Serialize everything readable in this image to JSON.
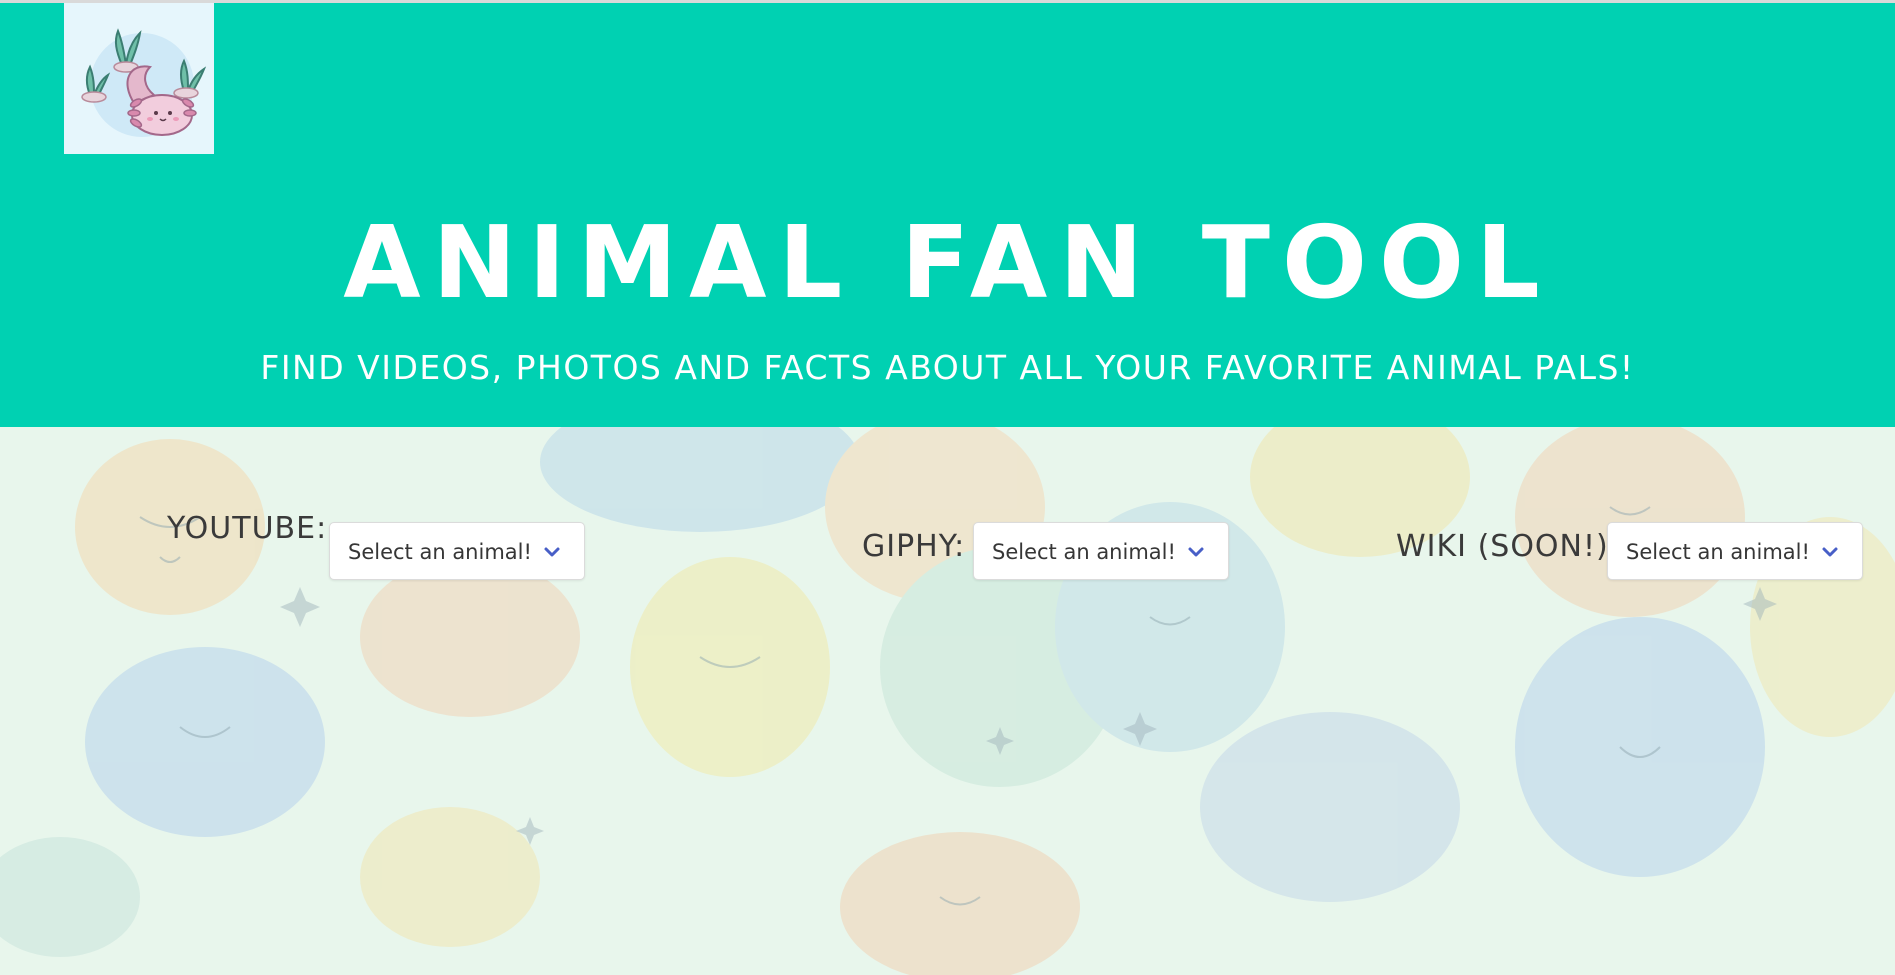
{
  "header": {
    "logo_icon": "axolotl-logo-icon",
    "title": "ANIMAL FAN TOOL",
    "subtitle": "FIND VIDEOS, PHOTOS AND FACTS ABOUT ALL YOUR FAVORITE ANIMAL PALS!"
  },
  "controls": {
    "youtube": {
      "label": "YOUTUBE:",
      "selected": "Select an animal!"
    },
    "giphy": {
      "label": "GIPHY:",
      "selected": "Select an animal!"
    },
    "wiki": {
      "label": "WIKI (SOON!):",
      "selected": "Select an animal!"
    }
  },
  "colors": {
    "hero": "#00d1b2",
    "chevron": "#485fc7",
    "background": "#e8f6ec"
  },
  "icons": {
    "dropdown": "chevron-down-icon",
    "background": "dog-pattern-background"
  }
}
